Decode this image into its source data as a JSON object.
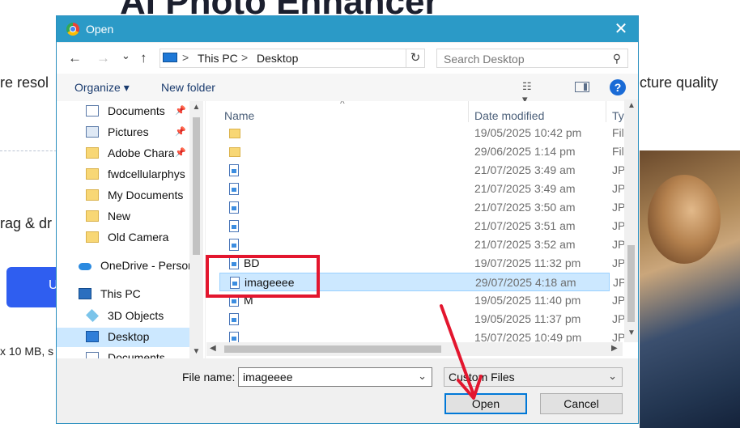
{
  "background_page": {
    "title": "AI Photo Enhancer",
    "text_left_1": "re resol",
    "text_right_1": "cture quality",
    "text_left_2": "rag & dr",
    "text_left_3": "x 10 MB, s",
    "button_text": "U"
  },
  "dialog": {
    "title": "Open",
    "close_glyph": "✕",
    "nav": {
      "back": "←",
      "forward": "→",
      "recent": "⌄",
      "up": "↑"
    },
    "address": {
      "crumbs": [
        "This PC",
        "Desktop"
      ],
      "sep": ">",
      "dropdown": "⌄",
      "refresh": "↻"
    },
    "search": {
      "placeholder": "Search Desktop",
      "icon": "⚲"
    },
    "toolbar": {
      "organize": "Organize ▾",
      "new_folder": "New folder",
      "view_icon": "☷ ▾",
      "help": "?"
    },
    "nav_items": [
      {
        "label": "Documents",
        "icon": "document-icon",
        "pinned": true
      },
      {
        "label": "Pictures",
        "icon": "pictures-icon",
        "pinned": true
      },
      {
        "label": "Adobe Chara",
        "icon": "folder-icon",
        "pinned": true
      },
      {
        "label": "fwdcellularphys",
        "icon": "folder-icon",
        "pinned": false
      },
      {
        "label": "My Documents",
        "icon": "folder-icon",
        "pinned": false
      },
      {
        "label": "New",
        "icon": "folder-icon",
        "pinned": false
      },
      {
        "label": "Old Camera",
        "icon": "folder-icon",
        "pinned": false
      },
      {
        "label": "OneDrive - Person",
        "icon": "cloud-icon",
        "pinned": false
      },
      {
        "label": "This PC",
        "icon": "pc-icon",
        "pinned": false
      },
      {
        "label": "3D Objects",
        "icon": "3d-objects-icon",
        "pinned": false
      },
      {
        "label": "Desktop",
        "icon": "desktop-icon",
        "pinned": false,
        "selected": true
      },
      {
        "label": "Documents",
        "icon": "document-icon",
        "pinned": false
      }
    ],
    "pin_glyph": "📌",
    "columns": {
      "name": "Name",
      "date": "Date modified",
      "type": "Ty",
      "sort_glyph": "^"
    },
    "files": [
      {
        "name": "",
        "date": "19/05/2025 10:42 pm",
        "type": "Fil",
        "icon": "folder-icon"
      },
      {
        "name": "",
        "date": "29/06/2025 1:14 pm",
        "type": "Fil",
        "icon": "folder-icon"
      },
      {
        "name": "",
        "date": "21/07/2025 3:49 am",
        "type": "JP",
        "icon": "image-file-icon"
      },
      {
        "name": "",
        "date": "21/07/2025 3:49 am",
        "type": "JP",
        "icon": "image-file-icon"
      },
      {
        "name": "",
        "date": "21/07/2025 3:50 am",
        "type": "JP",
        "icon": "image-file-icon"
      },
      {
        "name": "",
        "date": "21/07/2025 3:51 am",
        "type": "JP",
        "icon": "image-file-icon"
      },
      {
        "name": "",
        "date": "21/07/2025 3:52 am",
        "type": "JP",
        "icon": "image-file-icon"
      },
      {
        "name": "BD",
        "date": "19/07/2025 11:32 pm",
        "type": "JP",
        "icon": "image-file-icon"
      },
      {
        "name": "imageeee",
        "date": "29/07/2025 4:18 am",
        "type": "JP",
        "icon": "image-file-icon",
        "selected": true
      },
      {
        "name": "M",
        "date": "19/05/2025 11:40 pm",
        "type": "JP",
        "icon": "image-file-icon"
      },
      {
        "name": "",
        "date": "19/05/2025 11:37 pm",
        "type": "JP",
        "icon": "image-file-icon"
      },
      {
        "name": "",
        "date": "15/07/2025 10:49 pm",
        "type": "JP",
        "icon": "image-file-icon"
      }
    ],
    "file_name_label": "File name:",
    "file_name_value": "imageeee",
    "file_type_value": "Custom Files",
    "dropdown_glyph": "⌄",
    "open_button": "Open",
    "cancel_button": "Cancel",
    "scroll": {
      "up": "▲",
      "down": "▼",
      "left": "◀",
      "right": "▶"
    },
    "colors": {
      "title_bar": "#2b9ac7",
      "selection": "#cce8ff",
      "annotation": "#e3162e"
    }
  }
}
